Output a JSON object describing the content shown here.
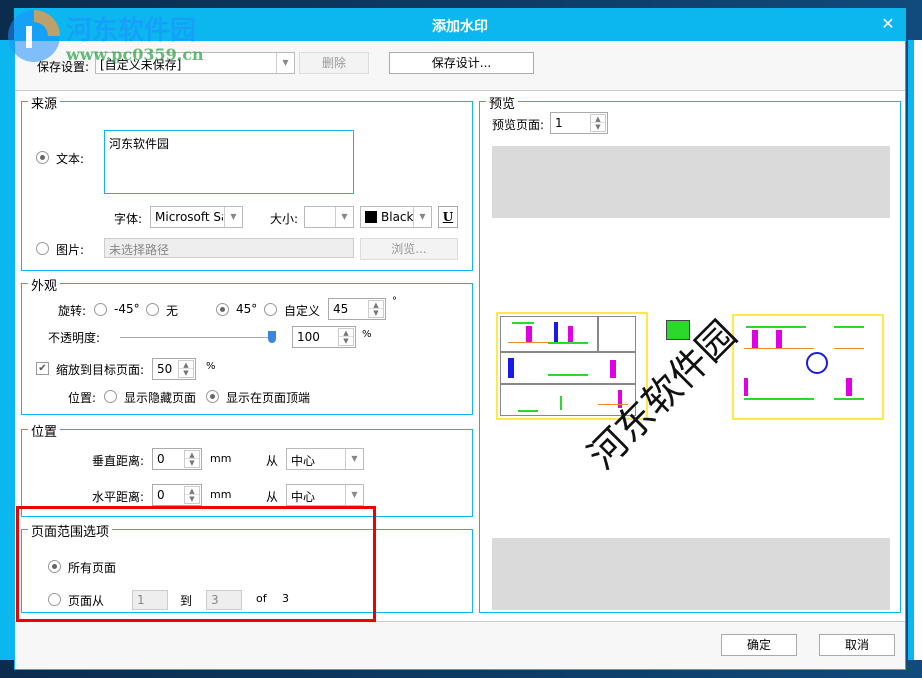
{
  "dialog": {
    "title": "添加水印",
    "close_icon": "close-icon"
  },
  "toolbar": {
    "save_settings_label": "保存设置:",
    "save_settings_value": "[自定义未保存]",
    "delete_label": "删除",
    "save_design_label": "保存设计..."
  },
  "source": {
    "legend": "来源",
    "text_label": "文本:",
    "text_selected": true,
    "text_value": "河东软件园",
    "font_label": "字体:",
    "font_value": "Microsoft Sans",
    "size_label": "大小:",
    "size_value": "",
    "color_value": "Black",
    "color_hex": "#000000",
    "underline_label": "U",
    "image_label": "图片:",
    "image_path_placeholder": "未选择路径",
    "browse_label": "浏览..."
  },
  "appearance": {
    "legend": "外观",
    "rotation_label": "旋转:",
    "rotation_options": [
      "-45°",
      "无",
      "45°",
      "自定义"
    ],
    "rotation_selected": "45°",
    "rotation_custom_value": "45",
    "degree_unit": "°",
    "opacity_label": "不透明度:",
    "opacity_value": "100",
    "opacity_fraction": 1.0,
    "percent_unit": "%",
    "scale_label": "缩放到目标页面:",
    "scale_checked": true,
    "scale_value": "50",
    "position_label": "位置:",
    "position_options": [
      "显示隐藏页面",
      "显示在页面顶端"
    ],
    "position_selected": "显示在页面顶端"
  },
  "position": {
    "legend": "位置",
    "vertical_label": "垂直距离:",
    "vertical_value": "0",
    "horizontal_label": "水平距离:",
    "horizontal_value": "0",
    "unit": "mm",
    "from_label": "从",
    "vertical_from": "中心",
    "horizontal_from": "中心"
  },
  "page_range": {
    "legend": "页面范围选项",
    "all_pages_label": "所有页面",
    "all_pages_selected": true,
    "range_label": "页面从",
    "range_from": "1",
    "to_label": "到",
    "range_to": "3",
    "of_label": "of",
    "total_pages": "3"
  },
  "preview": {
    "legend": "预览",
    "page_label": "预览页面:",
    "page_value": "1",
    "watermark_text": "河东软件园"
  },
  "footer": {
    "ok_label": "确定",
    "cancel_label": "取消"
  },
  "overlay": {
    "site_name": "河东软件园",
    "site_url": "www.pc0359.cn",
    "highlight_color": "#ee0000"
  },
  "colors": {
    "accent": "#0cb7ef",
    "highlight": "#ee0000"
  }
}
